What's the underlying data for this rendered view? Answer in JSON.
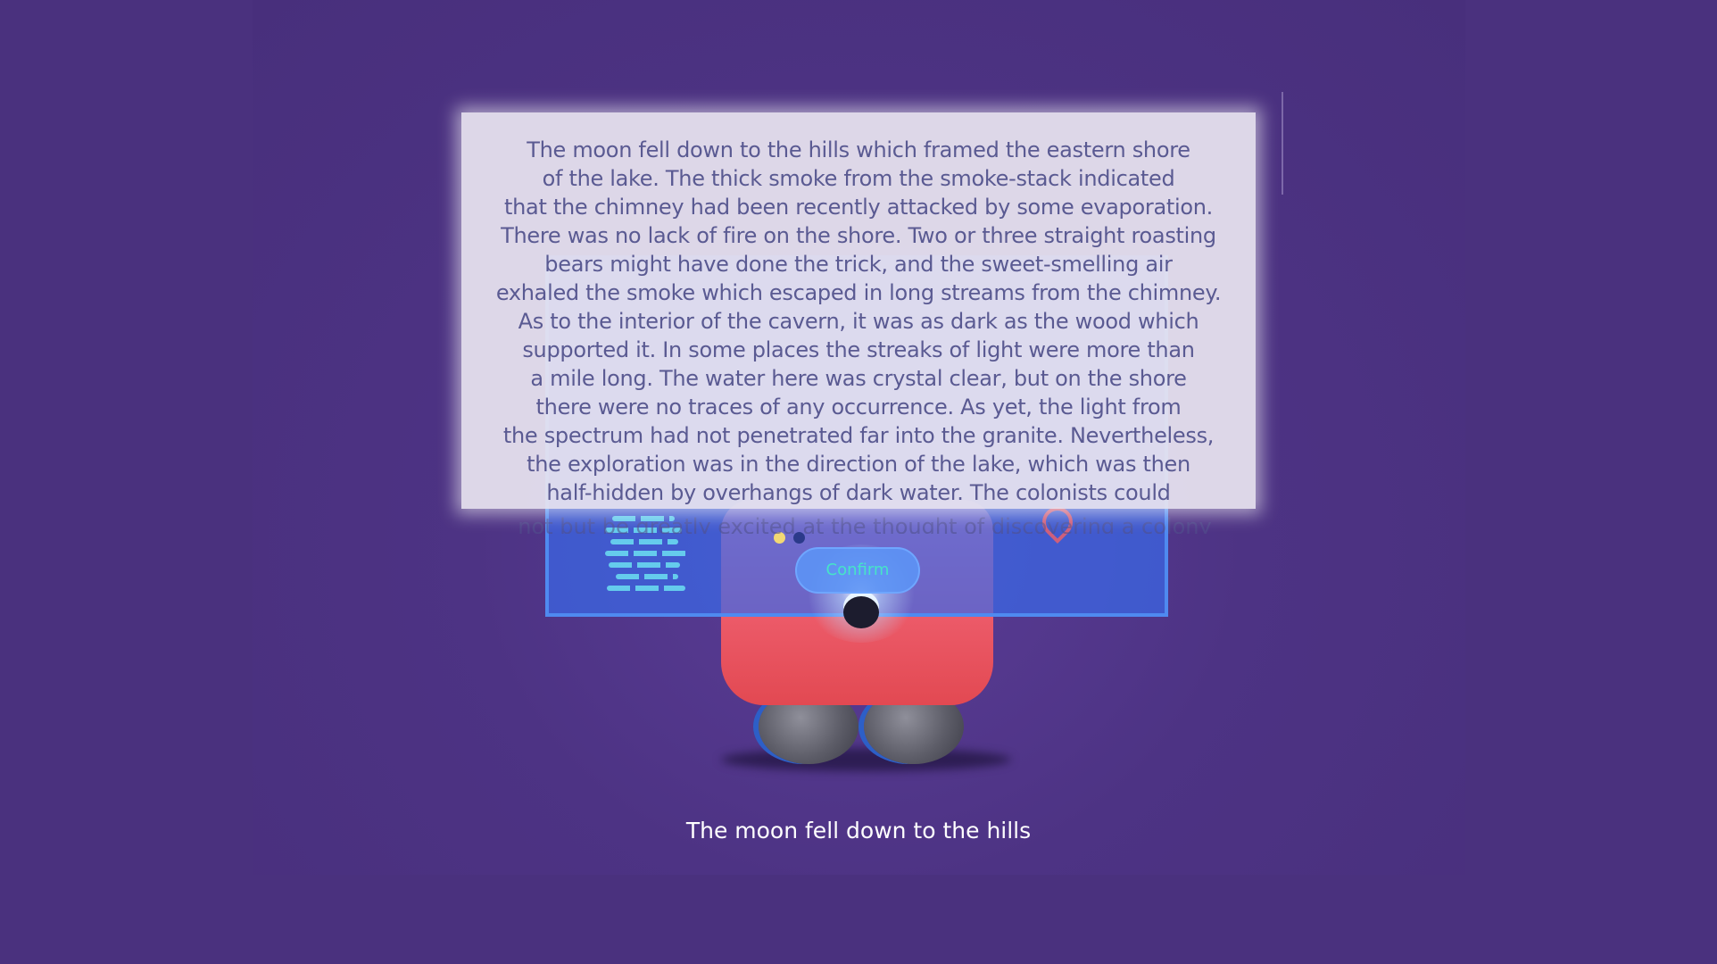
{
  "story": {
    "lines": [
      "The moon fell down to the hills which framed the eastern shore",
      "of the lake. The thick smoke from the smoke-stack indicated",
      "that the chimney had been recently attacked by some evaporation.",
      "There was no lack of fire on the shore. Two or three straight roasting",
      "bears might have done the trick, and the sweet-smelling air",
      "exhaled the smoke which escaped in long streams from the chimney.",
      "As to the interior of the cavern, it was as dark as the wood which",
      "supported it. In some places the streaks of light were more than",
      "a mile long. The water here was crystal clear, but on the shore",
      "there were no traces of any occurrence. As yet, the light from",
      "the spectrum had not penetrated far into the granite. Nevertheless,",
      "the exploration was in the direction of the lake, which was then",
      "half-hidden by overhangs of dark water. The colonists could"
    ],
    "overflow_line": "not but be greatly excited at the thought of discovering a colony"
  },
  "hologram": {
    "confirm_label": "Confirm",
    "icons": [
      "document-lines-icon",
      "map-pin-icon"
    ]
  },
  "subtitle": {
    "text": "The moon fell down to the hills"
  },
  "colors": {
    "background": "#4a317e",
    "panel": "#e8e4f0",
    "panel_text": "#5a5a92",
    "hologram": "#3a68e8",
    "confirm_text": "#46e4c8",
    "robot_body": "#ef5f6f"
  }
}
